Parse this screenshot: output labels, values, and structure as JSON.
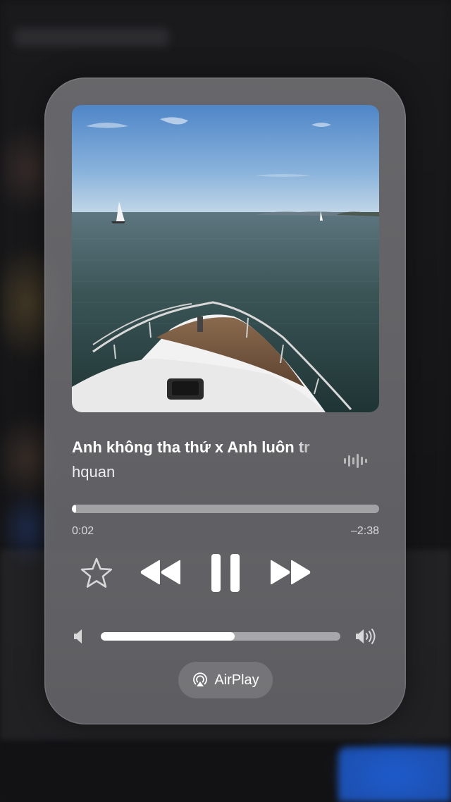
{
  "now_playing": {
    "title": "Anh không tha thứ x Anh luôn tr",
    "artist": "hquan",
    "progress": 0.0125,
    "elapsed": "0:02",
    "remaining": "–2:38"
  },
  "controls": {
    "favorite_icon": "star-icon",
    "previous_icon": "rewind-icon",
    "play_pause_icon": "pause-icon",
    "next_icon": "fast-forward-icon",
    "live_activity_icon": "waveform-icon"
  },
  "volume": {
    "level": 0.56,
    "low_icon": "speaker-low-icon",
    "high_icon": "speaker-high-icon"
  },
  "airplay": {
    "label": "AirPlay",
    "icon": "airplay-icon"
  },
  "colors": {
    "card": "#747478",
    "foreground": "#ffffff",
    "track": "#b9b9bb"
  }
}
